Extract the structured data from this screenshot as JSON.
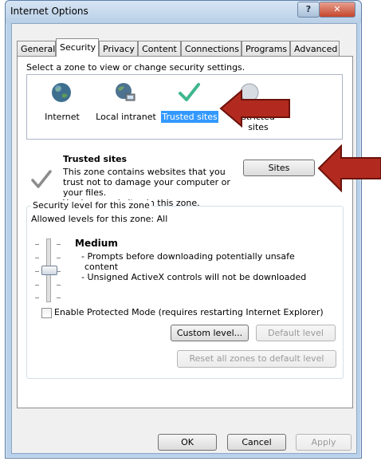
{
  "window": {
    "title": "Internet Options",
    "help_label": "?",
    "close_label": "✕"
  },
  "tabs": [
    "General",
    "Security",
    "Privacy",
    "Content",
    "Connections",
    "Programs",
    "Advanced"
  ],
  "active_tab": "Security",
  "zones": {
    "prompt": "Select a zone to view or change security settings.",
    "items": [
      {
        "label": "Internet",
        "icon": "globe-icon"
      },
      {
        "label": "Local intranet",
        "icon": "network-globe-icon"
      },
      {
        "label": "Trusted sites",
        "icon": "checkmark-icon",
        "selected": true
      },
      {
        "label": "stricted sites",
        "icon": "restricted-icon"
      }
    ]
  },
  "zone_info": {
    "title": "Trusted sites",
    "line1": "This zone contains websites that you",
    "line2": "trust not to damage your computer or",
    "line3": "your files.",
    "line4": "You have websites in this zone.",
    "sites_button": "Sites"
  },
  "security_level": {
    "group_title": "Security level for this zone",
    "allowed": "Allowed levels for this zone: All",
    "level": "Medium",
    "bullet1a": "- Prompts before downloading potentially unsafe",
    "bullet1b": "content",
    "bullet2": "- Unsigned ActiveX controls will not be downloaded",
    "protected_mode": "Enable Protected Mode (requires restarting Internet Explorer)",
    "custom_level": "Custom level...",
    "default_level": "Default level",
    "reset_all": "Reset all zones to default level"
  },
  "footer": {
    "ok": "OK",
    "cancel": "Cancel",
    "apply": "Apply"
  },
  "colors": {
    "accent_arrow": "#b22a1f",
    "selection": "#3399ff",
    "check_green": "#3fb68e"
  }
}
